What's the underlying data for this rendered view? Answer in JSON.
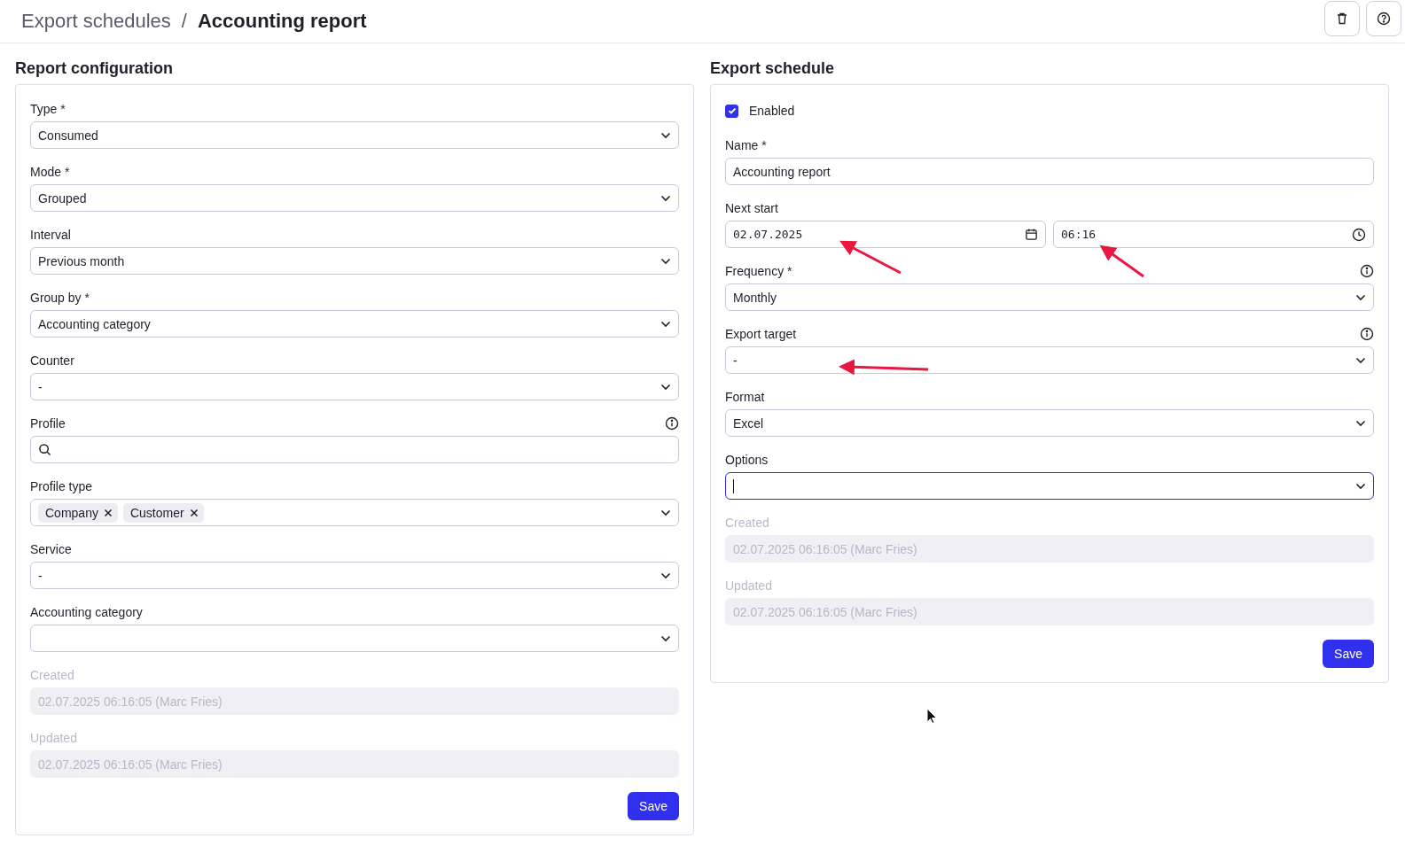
{
  "breadcrumb": {
    "parent": "Export schedules",
    "separator": "/",
    "current": "Accounting report"
  },
  "toolbar": {
    "buttons": [
      {
        "kind": "delete"
      },
      {
        "kind": "help"
      }
    ]
  },
  "report_configuration": {
    "title": "Report configuration",
    "fields": [
      {
        "kind": "select",
        "label": "Type *",
        "value": "Consumed"
      },
      {
        "kind": "select",
        "label": "Mode *",
        "value": "Grouped"
      },
      {
        "kind": "select",
        "label": "Interval",
        "value": "Previous month"
      },
      {
        "kind": "select",
        "label": "Group by *",
        "value": "Accounting category"
      },
      {
        "kind": "select",
        "label": "Counter",
        "value": "-"
      },
      {
        "kind": "search",
        "label": "Profile",
        "info": true
      },
      {
        "kind": "tags",
        "label": "Profile type",
        "tags": [
          "Company",
          "Customer"
        ]
      },
      {
        "kind": "select",
        "label": "Service",
        "value": "-"
      },
      {
        "kind": "select",
        "label": "Accounting category"
      },
      {
        "kind": "readonly",
        "label": "Created",
        "value": "02.07.2025 06:16:05 (Marc Fries)"
      },
      {
        "kind": "readonly",
        "label": "Updated",
        "value": "02.07.2025 06:16:05 (Marc Fries)"
      }
    ],
    "save": "Save"
  },
  "export_schedule": {
    "title": "Export schedule",
    "fields": [
      {
        "kind": "checkbox",
        "label": "Enabled",
        "checked": true
      },
      {
        "kind": "text",
        "label": "Name *",
        "value": "Accounting report"
      },
      {
        "kind": "datetime",
        "label": "Next start",
        "date": "02.07.2025",
        "time": "06:16"
      },
      {
        "kind": "select",
        "label": "Frequency *",
        "value": "Monthly",
        "info": true
      },
      {
        "kind": "select",
        "label": "Export target",
        "value": "-",
        "info": true
      },
      {
        "kind": "select",
        "label": "Format",
        "value": "Excel"
      },
      {
        "kind": "select",
        "label": "Options",
        "focused": true
      },
      {
        "kind": "readonly",
        "label": "Created",
        "value": "02.07.2025 06:16:05 (Marc Fries)"
      },
      {
        "kind": "readonly",
        "label": "Updated",
        "value": "02.07.2025 06:16:05 (Marc Fries)"
      }
    ],
    "save": "Save"
  }
}
